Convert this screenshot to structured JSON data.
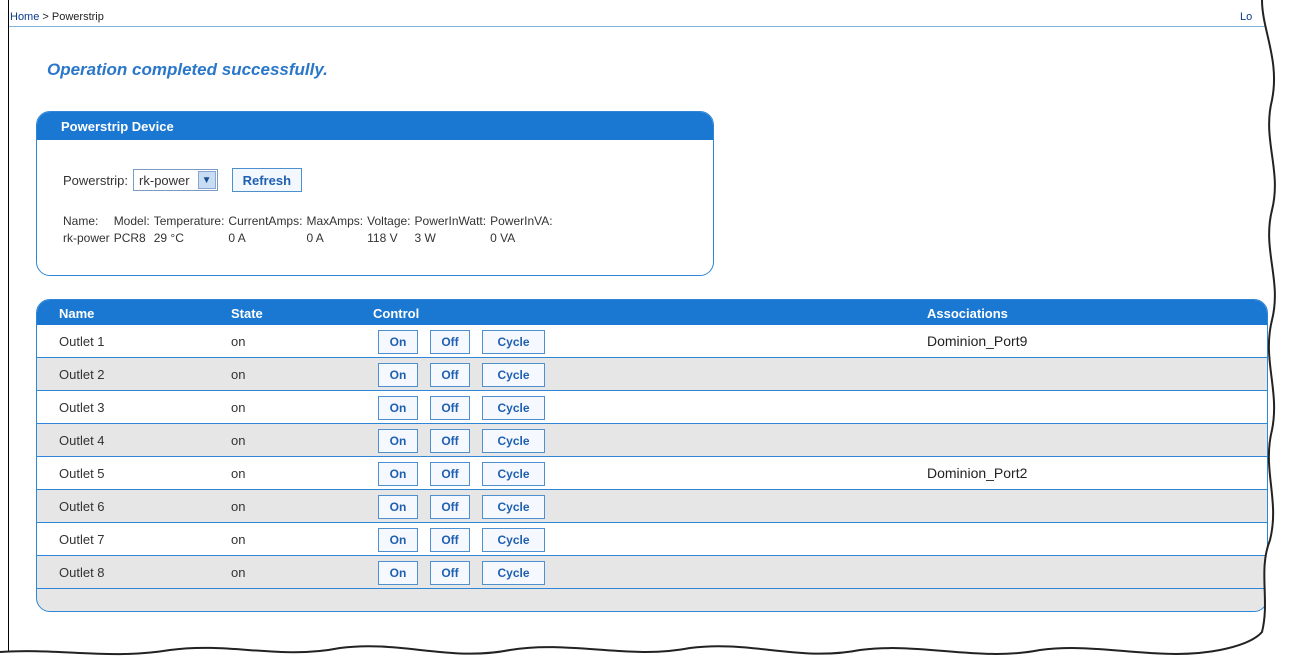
{
  "breadcrumb": {
    "home": "Home",
    "sep": " > ",
    "current": "Powerstrip"
  },
  "logout_label": "Lo",
  "message": "Operation completed successfully.",
  "device_panel": {
    "title": "Powerstrip Device",
    "powerstrip_label": "Powerstrip:",
    "selected": "rk-power",
    "refresh_label": "Refresh",
    "headers": [
      "Name:",
      "Model:",
      "Temperature:",
      "CurrentAmps:",
      "MaxAmps:",
      "Voltage:",
      "PowerInWatt:",
      "PowerInVA:"
    ],
    "values": [
      "rk-power",
      "PCR8",
      "29 °C",
      "0 A",
      "0 A",
      "118 V",
      "3 W",
      "0 VA"
    ]
  },
  "outlets_table": {
    "headers": {
      "name": "Name",
      "state": "State",
      "control": "Control",
      "associations": "Associations"
    },
    "buttons": {
      "on": "On",
      "off": "Off",
      "cycle": "Cycle"
    },
    "rows": [
      {
        "name": "Outlet 1",
        "state": "on",
        "assoc": "Dominion_Port9"
      },
      {
        "name": "Outlet 2",
        "state": "on",
        "assoc": ""
      },
      {
        "name": "Outlet 3",
        "state": "on",
        "assoc": ""
      },
      {
        "name": "Outlet 4",
        "state": "on",
        "assoc": ""
      },
      {
        "name": "Outlet 5",
        "state": "on",
        "assoc": "Dominion_Port2"
      },
      {
        "name": "Outlet 6",
        "state": "on",
        "assoc": ""
      },
      {
        "name": "Outlet 7",
        "state": "on",
        "assoc": ""
      },
      {
        "name": "Outlet 8",
        "state": "on",
        "assoc": ""
      }
    ]
  },
  "colors": {
    "accent": "#1a78d2",
    "message": "#2a77c9",
    "row_alt": "#e6e6e6"
  }
}
